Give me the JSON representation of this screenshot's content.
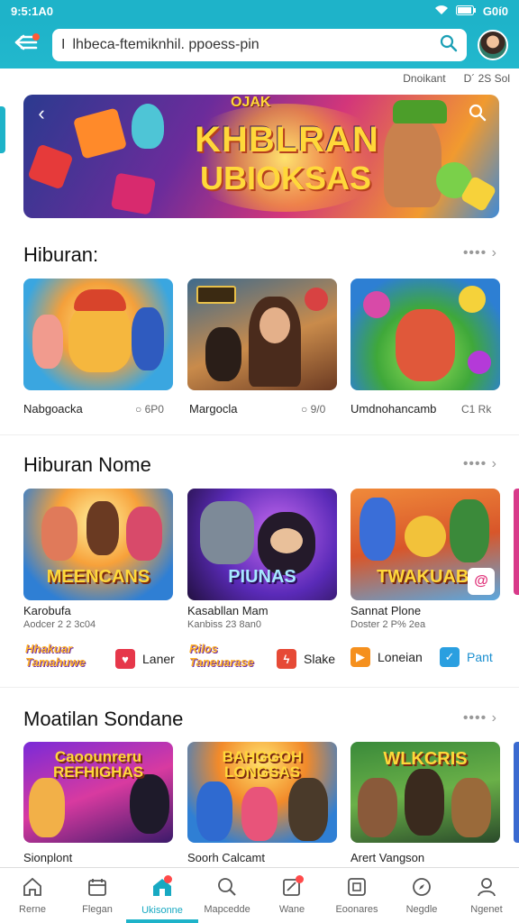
{
  "status_bar": {
    "time": "9:5:1A0",
    "battery": "G0í0"
  },
  "search": {
    "text": "lhbeca-ftemiknhil. ppoess-pin"
  },
  "meta": {
    "left": "Dnoikant",
    "right": "D´ 2S Sol"
  },
  "hero": {
    "tag": "OJAK",
    "line1": "KHBLRAN",
    "line2": "UBIOKSAS"
  },
  "sections": [
    {
      "title": "Hiburan:",
      "items": [
        {
          "label": "Nabgoacka",
          "count": "○ 6P0"
        },
        {
          "label": "Margocla",
          "count": "○ 9/0"
        },
        {
          "label": "Umdnohancamb",
          "count": "C1 Rk"
        }
      ]
    },
    {
      "title": "Hiburan Nome",
      "items": [
        {
          "label": "Karobufa",
          "sub": "Aodcer 2 2 3c04",
          "caption": "MEENCANS"
        },
        {
          "label": "Kasabllan Mam",
          "sub": "Kanbiss 23 8an0",
          "caption": "PIUNAS"
        },
        {
          "label": "Sannat Plone",
          "sub": "Doster 2 P% 2ea",
          "caption": "TWAKUABI"
        }
      ],
      "chips": [
        {
          "logo": "Hhakuar Tamahuwe",
          "label": "Laner"
        },
        {
          "logo": "Rilos Taneuarase",
          "label": "Slake"
        },
        {
          "label": "Loneian"
        },
        {
          "label": "Pant"
        }
      ]
    },
    {
      "title": "Moatilan Sondane",
      "items": [
        {
          "label": "Sionplont",
          "caption": "Caoounreru REFHIGHAS"
        },
        {
          "label": "Soorh Calcamt",
          "caption": "BAHGGOH LONGSAS"
        },
        {
          "label": "Arert Vangson",
          "caption": "WLKCRIS"
        }
      ]
    }
  ],
  "bottom_nav": [
    {
      "label": "Rerne",
      "icon": "home-icon"
    },
    {
      "label": "Flegan",
      "icon": "calendar-icon"
    },
    {
      "label": "Ukisonne",
      "icon": "store-icon",
      "active": true
    },
    {
      "label": "Mapcedde",
      "icon": "search-icon"
    },
    {
      "label": "Wane",
      "icon": "edit-icon"
    },
    {
      "label": "Eoonares",
      "icon": "box-icon"
    },
    {
      "label": "Negdle",
      "icon": "compass-icon"
    },
    {
      "label": "Ngenet",
      "icon": "user-icon"
    }
  ],
  "colors": {
    "accent": "#1eb3c9",
    "active": "#18a9c2"
  }
}
